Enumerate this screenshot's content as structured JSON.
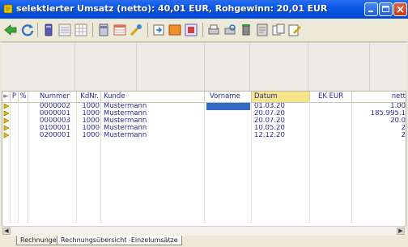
{
  "window": {
    "title": "selektierter Umsatz (netto): 40,01 EUR, Rohgewinn: 20,01 EUR"
  },
  "toolbar": {
    "icons": [
      "back-arrow-icon",
      "refresh-icon",
      "database-icon",
      "list-view-icon",
      "grid-view-icon",
      "document-icon",
      "table-icon",
      "tools-icon",
      "open-icon",
      "calendar-icon",
      "form-icon",
      "print-icon",
      "print-preview-icon",
      "delete-icon",
      "export-icon",
      "copy-icon",
      "edit-icon"
    ]
  },
  "grid": {
    "columns": [
      "P",
      "%",
      "Nummer",
      "KdNr.",
      "Kunde",
      "Vorname",
      "Datum",
      "EK EUR",
      "nett"
    ],
    "rows": [
      {
        "nummer": "0000002",
        "kdnr": "1000",
        "kunde": "Mustermann",
        "vorname": "",
        "datum": "01.03.20",
        "ek": "",
        "netto": "1.00"
      },
      {
        "nummer": "0000001",
        "kdnr": "1000",
        "kunde": "Mustermann",
        "vorname": "",
        "datum": "20.07.20",
        "ek": "",
        "netto": "185.995.1"
      },
      {
        "nummer": "0000003",
        "kdnr": "1000",
        "kunde": "Mustermann",
        "vorname": "",
        "datum": "20.07.20",
        "ek": "",
        "netto": "20.0"
      },
      {
        "nummer": "0100001",
        "kdnr": "1000",
        "kunde": "Mustermann",
        "vorname": "",
        "datum": "10.05.20",
        "ek": "",
        "netto": "2"
      },
      {
        "nummer": "0200001",
        "kdnr": "1000",
        "kunde": "Mustermann",
        "vorname": "",
        "datum": "12.12.20",
        "ek": "",
        "netto": "2"
      }
    ]
  },
  "tabs": [
    "Rechnungen",
    "Rechnungsübersicht -Einzelumsätze"
  ],
  "colors": {
    "titlebar": "#0a5ae6",
    "selected_header": "#f7e58a",
    "selection": "#316ac5",
    "text": "#2a2a9a"
  }
}
